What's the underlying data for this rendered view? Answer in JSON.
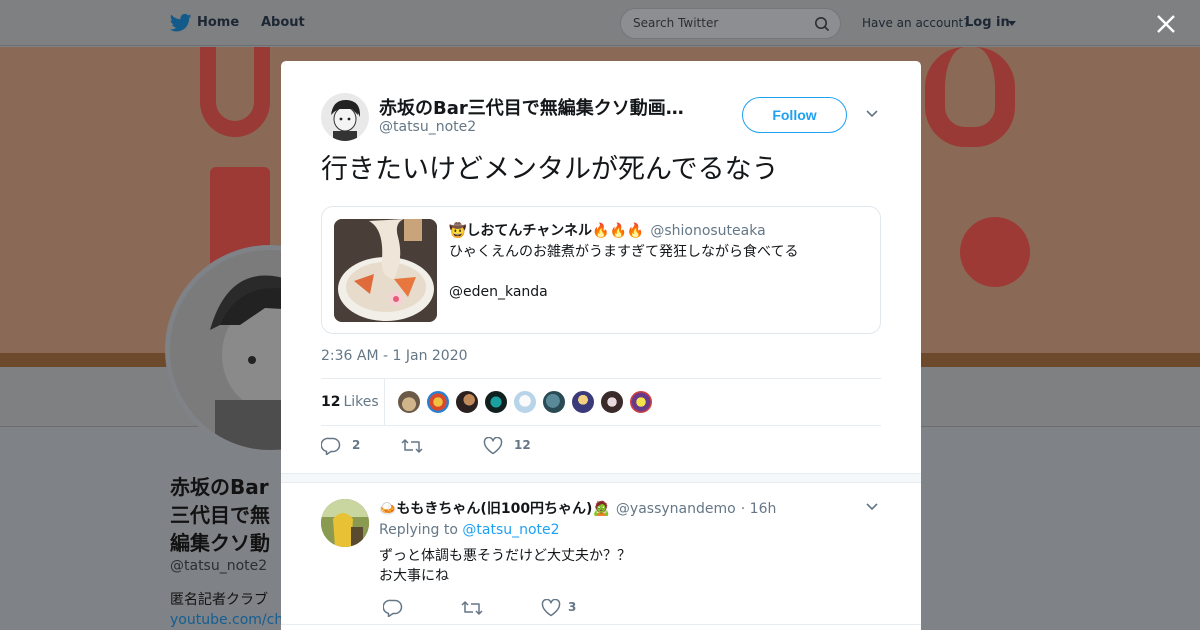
{
  "nav": {
    "home_label": "Home",
    "about_label": "About",
    "search_placeholder": "Search Twitter",
    "have_account": "Have an account?",
    "login_label": "Log in"
  },
  "profile": {
    "display_name": "赤坂のBar三代目で無編集クソ動画を撮るトタツノリ",
    "handle": "@tatsu_note2",
    "bio_text": "匿名記者クラブ",
    "bio_link": "youtube.com/ch"
  },
  "tweet": {
    "author_name": "赤坂のBar三代目で無編集クソ動画…",
    "author_handle": "@tatsu_note2",
    "follow_label": "Follow",
    "text": "行きたいけどメンタルが死んでるなう",
    "timestamp": "2:36 AM - 1 Jan 2020",
    "likes_count": "12",
    "likes_label": "Likes",
    "reply_count": "2",
    "retweet_count": "",
    "like_count": "12",
    "quote": {
      "name_emoji_prefix": "🤠",
      "name": "しおてんチャンネル",
      "name_emoji_suffix": "🔥🔥🔥",
      "handle": "@shionosuteaka",
      "text": "ひゃくえんのお雑煮がうますぎて発狂しながら食べてる\n\n@eden_kanda"
    },
    "likers": [
      "liker-1",
      "liker-2",
      "liker-3",
      "liker-4",
      "liker-5",
      "liker-6",
      "liker-7",
      "liker-8",
      "liker-9"
    ]
  },
  "reply": {
    "name_emoji_prefix": "🍛",
    "name": "ももきちゃん(旧100円ちゃん)",
    "name_emoji_suffix": "🧟",
    "handle": "@yassynandemo",
    "time": "· 16h",
    "replying_prefix": "Replying to",
    "replying_to": "@tatsu_note2",
    "text": "ずっと体調も悪そうだけど大丈夫か？？\nお大事にね",
    "reply_count": "",
    "retweet_count": "",
    "like_count": "3"
  },
  "colors": {
    "accent": "#1da1f2",
    "muted": "#657786",
    "overlay": "#7f8287"
  }
}
